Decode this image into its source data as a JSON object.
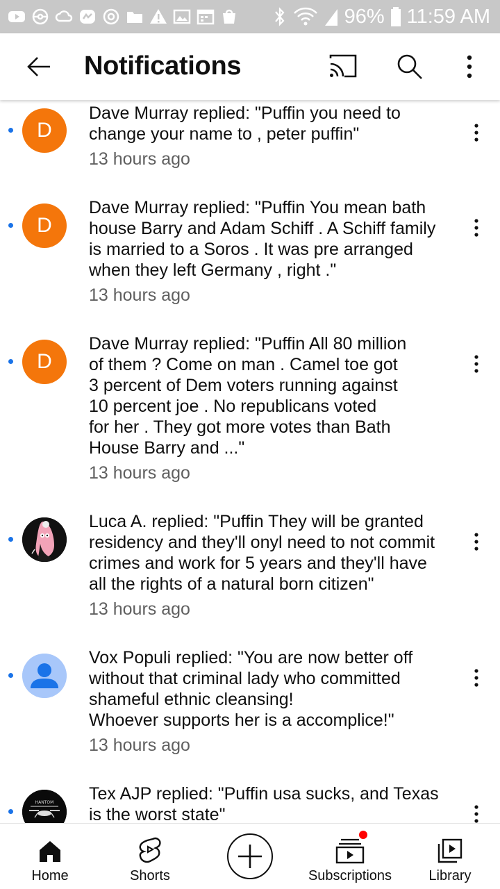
{
  "status_bar": {
    "battery": "96%",
    "time": "11:59 AM",
    "left_icons": [
      "youtube-icon",
      "pokeball-icon",
      "cloud-icon",
      "messenger-icon",
      "sync-icon",
      "folder-icon",
      "warning-icon",
      "gallery-icon",
      "calendar-icon",
      "shopping-bag-icon"
    ],
    "right_icons": [
      "bluetooth-icon",
      "wifi-icon",
      "signal-icon",
      "battery-icon"
    ]
  },
  "app_bar": {
    "title": "Notifications",
    "icons": [
      "back-arrow-icon",
      "cast-icon",
      "search-icon",
      "more-vert-icon"
    ]
  },
  "notifications": [
    {
      "avatar_type": "letter",
      "avatar_letter": "D",
      "avatar_color": "#f4760b",
      "text": "Dave Murray replied: \"Puffin you need to\nchange your name to , peter puffin\"",
      "time": "13 hours ago",
      "unread": true
    },
    {
      "avatar_type": "letter",
      "avatar_letter": "D",
      "avatar_color": "#f4760b",
      "text": "Dave Murray replied: \"Puffin You mean bath\nhouse Barry and Adam Schiff . A Schiff family\nis married to a Soros . It was pre arranged\nwhen they left Germany , right .\"",
      "time": "13 hours ago",
      "unread": true
    },
    {
      "avatar_type": "letter",
      "avatar_letter": "D",
      "avatar_color": "#f4760b",
      "text": "Dave Murray replied: \"Puffin All 80 million\nof them ? Come on man . Camel toe got\n3 percent of Dem voters running against\n10 percent joe . No republicans voted\nfor her . They got more votes than Bath\nHouse Barry and ...\"",
      "time": "13 hours ago",
      "unread": true
    },
    {
      "avatar_type": "image",
      "avatar_icon": "cartoon-avatar-icon",
      "text": "Luca A. replied: \"Puffin They will be granted\nresidency and they'll onyl need to not commit\ncrimes and work for 5 years and they'll have\nall the rights of a natural born citizen\"",
      "time": "13 hours ago",
      "unread": true
    },
    {
      "avatar_type": "default",
      "avatar_icon": "default-user-icon",
      "text": "Vox Populi replied: \"You are now better off\nwithout that criminal lady who committed\nshameful ethnic cleansing!\nWhoever supports her is a accomplice!\"",
      "time": "13 hours ago",
      "unread": true
    },
    {
      "avatar_type": "image",
      "avatar_icon": "drone-logo-avatar-icon",
      "text": "Tex AJP replied: \"Puffin usa sucks, and Texas\nis the worst state\"",
      "time": "",
      "unread": true
    }
  ],
  "bottom_nav": {
    "items": [
      {
        "label": "Home",
        "icon": "home-icon"
      },
      {
        "label": "Shorts",
        "icon": "shorts-icon"
      },
      {
        "label": "",
        "icon": "create-plus-icon"
      },
      {
        "label": "Subscriptions",
        "icon": "subscriptions-icon",
        "badge": true
      },
      {
        "label": "Library",
        "icon": "library-icon"
      }
    ],
    "badge_color": "#ff0000"
  },
  "colors": {
    "unread_dot": "#1a73e8",
    "avatar_orange": "#f4760b",
    "secondary_text": "#606060",
    "status_bar_bg": "#c8c8c8"
  }
}
